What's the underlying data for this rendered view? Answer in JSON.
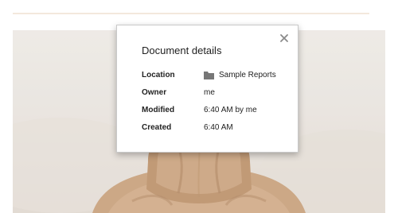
{
  "dialog": {
    "title": "Document details",
    "close_icon": "close-icon",
    "rows": [
      {
        "label": "Location",
        "value": "Sample Reports",
        "icon": "folder-icon"
      },
      {
        "label": "Owner",
        "value": "me"
      },
      {
        "label": "Modified",
        "value": "6:40 AM by me"
      },
      {
        "label": "Created",
        "value": "6:40 AM"
      }
    ]
  },
  "colors": {
    "rule": "#f3e8dc",
    "dialog_border": "#c9c9c9",
    "text": "#222222",
    "icon": "#777777",
    "photo_bg": "#ece8e3",
    "jacket": "#c9a27c"
  }
}
